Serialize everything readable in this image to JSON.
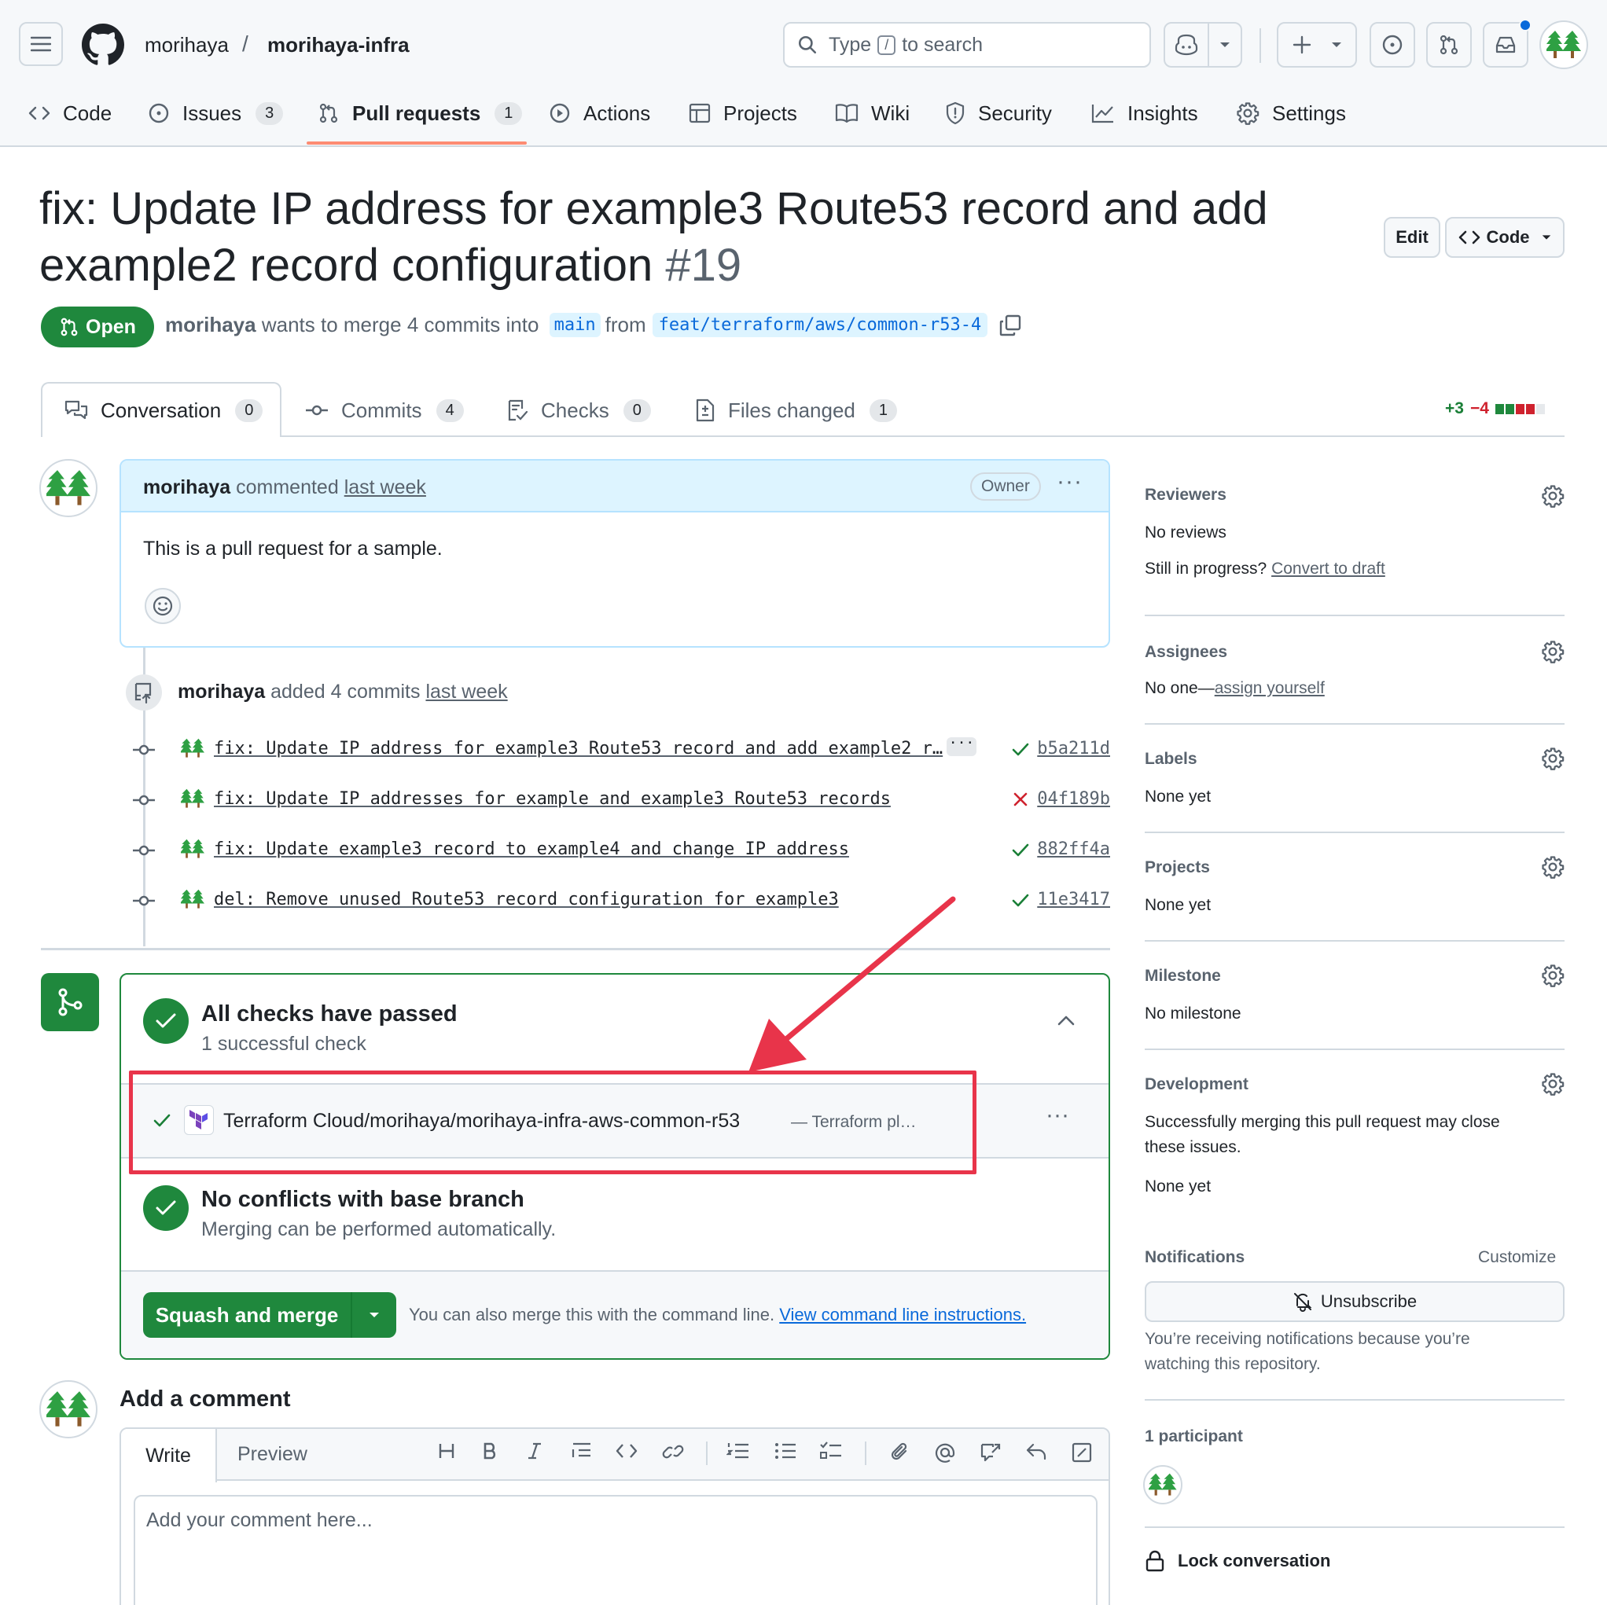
{
  "header": {
    "owner": "morihaya",
    "sep": "/",
    "repo": "morihaya-infra",
    "search_type": "Type",
    "search_key": "/",
    "search_rest": "to search"
  },
  "tabs": [
    {
      "label": "Code"
    },
    {
      "label": "Issues",
      "count": "3"
    },
    {
      "label": "Pull requests",
      "count": "1"
    },
    {
      "label": "Actions"
    },
    {
      "label": "Projects"
    },
    {
      "label": "Wiki"
    },
    {
      "label": "Security"
    },
    {
      "label": "Insights"
    },
    {
      "label": "Settings"
    }
  ],
  "pr": {
    "title_line1": "fix: Update IP address for example3 Route53 record and add",
    "title_line2": "example2 record configuration",
    "number": "#19",
    "edit": "Edit",
    "code_btn": "Code",
    "status": "Open",
    "author": "morihaya",
    "merge_text": "wants to merge 4 commits into",
    "base": "main",
    "from": "from",
    "head": "feat/terraform/aws/common-r53-4"
  },
  "pr_tabs": [
    {
      "label": "Conversation",
      "count": "0"
    },
    {
      "label": "Commits",
      "count": "4"
    },
    {
      "label": "Checks",
      "count": "0"
    },
    {
      "label": "Files changed",
      "count": "1"
    }
  ],
  "diffstat": {
    "add": "+3",
    "del": "−4"
  },
  "comment": {
    "author": "morihaya",
    "action": "commented",
    "time": "last week",
    "role": "Owner",
    "body": "This is a pull request for a sample."
  },
  "commits_event": {
    "author": "morihaya",
    "action": "added 4 commits",
    "time": "last week"
  },
  "commits": [
    {
      "msg": "fix: Update IP address for example3 Route53 record and add example2 r…",
      "sha": "b5a211d",
      "status": "pass"
    },
    {
      "msg": "fix: Update IP addresses for example and example3 Route53 records",
      "sha": "04f189b",
      "status": "fail"
    },
    {
      "msg": "fix: Update example3 record to example4 and change IP address",
      "sha": "882ff4a",
      "status": "pass"
    },
    {
      "msg": "del: Remove unused Route53 record configuration for example3",
      "sha": "11e3417",
      "status": "pass"
    }
  ],
  "checks": {
    "title": "All checks have passed",
    "subtitle": "1 successful check",
    "item": "Terraform Cloud/morihaya/morihaya-infra-aws-common-r53",
    "item_desc": "— Terraform pl…",
    "noconf_title": "No conflicts with base branch",
    "noconf_sub": "Merging can be performed automatically.",
    "merge_btn": "Squash and merge",
    "cli_text": "You can also merge this with the command line.",
    "cli_link": "View command line instructions."
  },
  "add_comment": {
    "title": "Add a comment",
    "write": "Write",
    "preview": "Preview",
    "placeholder": "Add your comment here..."
  },
  "sidebar": {
    "reviewers": "Reviewers",
    "no_reviews": "No reviews",
    "in_progress": "Still in progress?",
    "convert": "Convert to draft",
    "assignees": "Assignees",
    "no_one": "No one—",
    "assign": "assign yourself",
    "labels": "Labels",
    "none_yet": "None yet",
    "projects": "Projects",
    "milestone": "Milestone",
    "no_milestone": "No milestone",
    "development": "Development",
    "dev_text1": "Successfully merging this pull request may close",
    "dev_text2": "these issues.",
    "notifications": "Notifications",
    "customize": "Customize",
    "unsubscribe": "Unsubscribe",
    "notif_text1": "You’re receiving notifications because you’re",
    "notif_text2": "watching this repository.",
    "participants": "1 participant",
    "lock": "Lock conversation"
  },
  "colors": {
    "green": "#1f883d",
    "red": "#cf222e",
    "accent": "#0969da",
    "annotation": "#e8344a"
  }
}
